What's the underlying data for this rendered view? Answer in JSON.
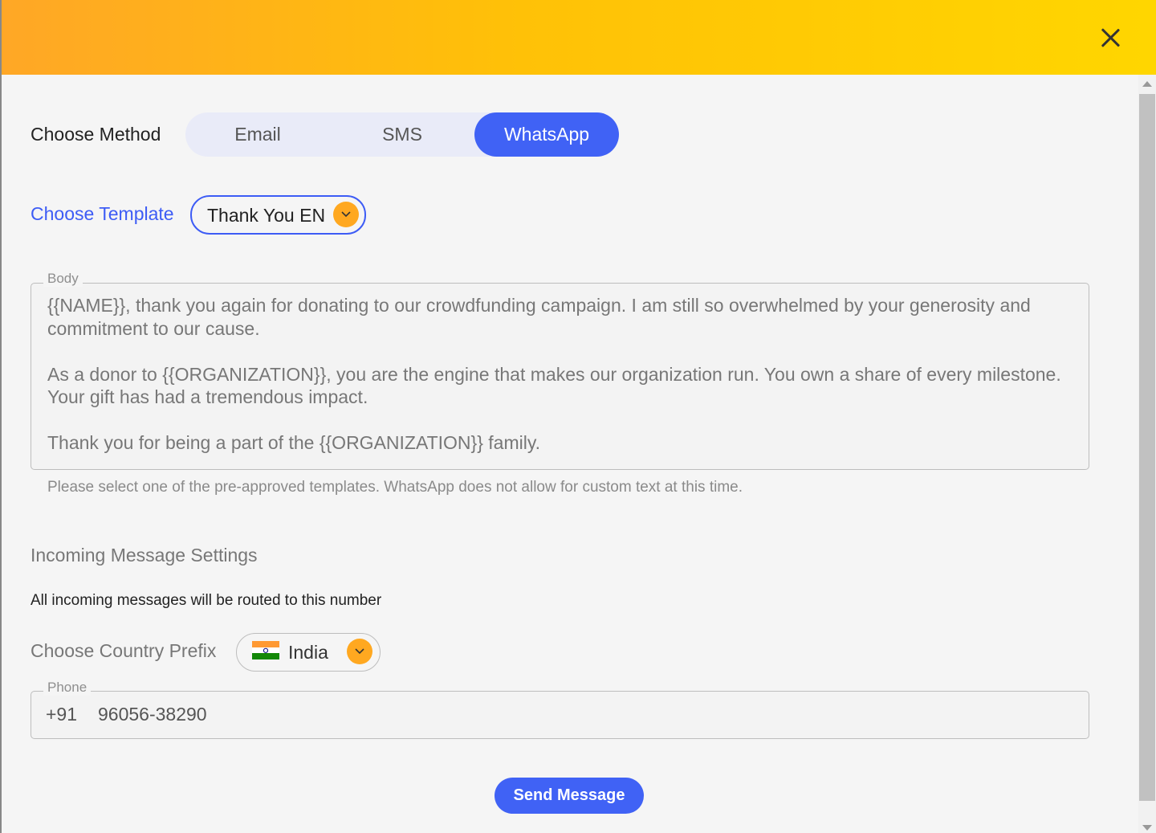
{
  "header": {
    "close_icon": "close-icon",
    "gradient_start": "#ffa726",
    "gradient_end": "#ffd600"
  },
  "method": {
    "label": "Choose Method",
    "options": [
      "Email",
      "SMS",
      "WhatsApp"
    ],
    "selected": "WhatsApp",
    "accent": "#4062f5"
  },
  "template": {
    "label": "Choose Template",
    "selected": "Thank You EN",
    "icon": "chevron-down-icon"
  },
  "body": {
    "label": "Body",
    "paragraphs": [
      "{{NAME}}, thank you again for donating to our crowdfunding campaign. I am still so overwhelmed by your generosity and commitment to our cause.",
      "As a donor to {{ORGANIZATION}}, you are the engine that makes our organization run. You own a share of every milestone. Your gift has had a tremendous impact.",
      "Thank you for being a part of the {{ORGANIZATION}} family."
    ],
    "helper": "Please select one of the pre-approved templates. WhatsApp does not allow for custom text at this time."
  },
  "incoming": {
    "title": "Incoming Message Settings",
    "description": "All incoming messages will be routed to this number"
  },
  "country": {
    "label": "Choose Country Prefix",
    "selected": "India",
    "flag_icon": "india-flag-icon",
    "icon": "chevron-down-icon"
  },
  "phone": {
    "label": "Phone",
    "prefix": "+91",
    "value": "96056-38290"
  },
  "send": {
    "label": "Send Message"
  }
}
